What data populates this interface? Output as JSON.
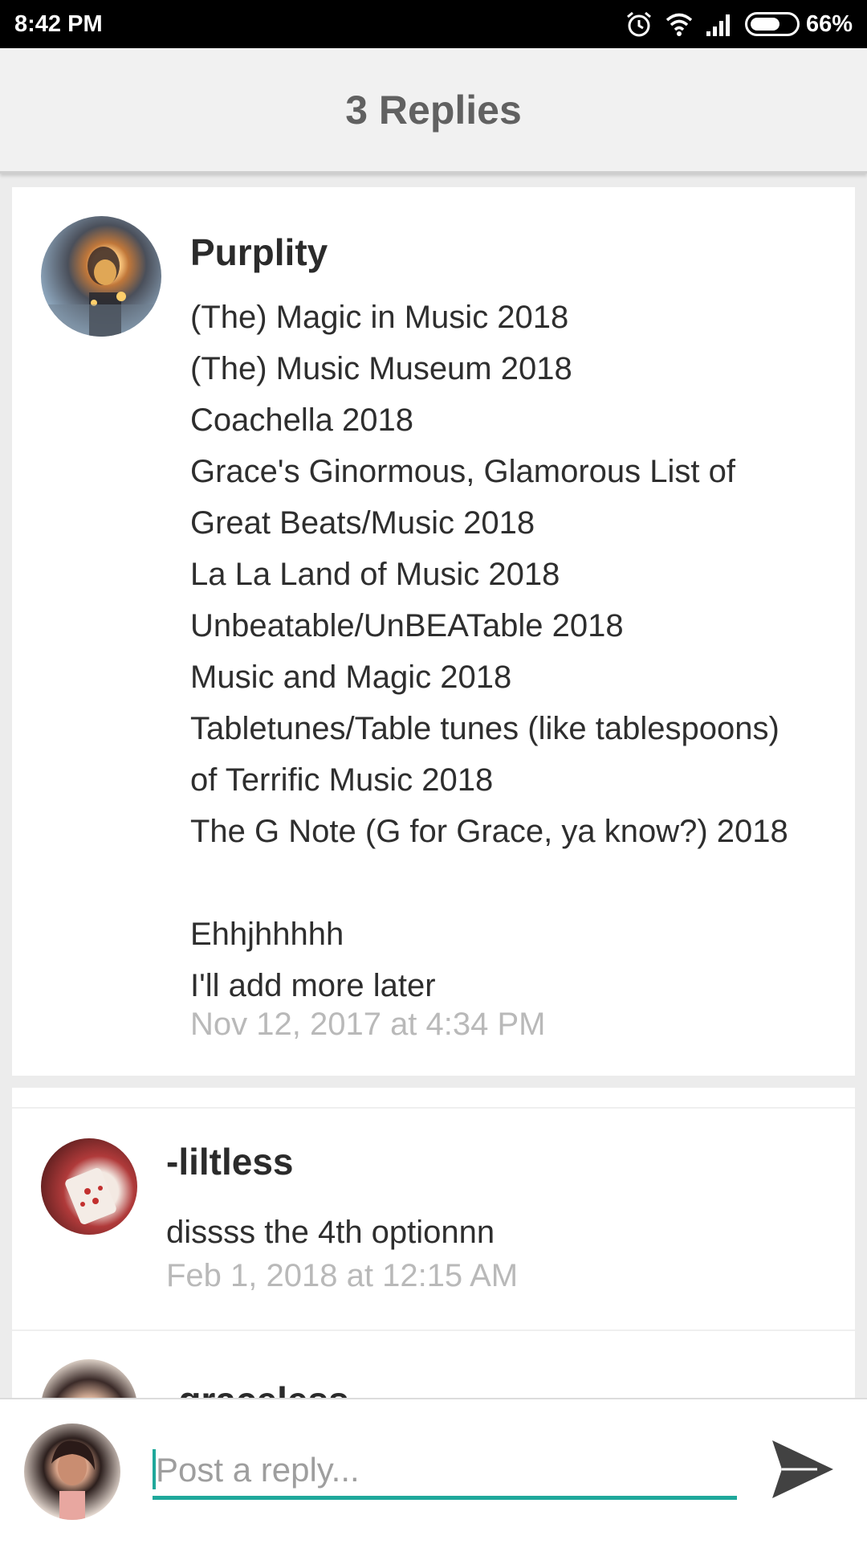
{
  "status_bar": {
    "time": "8:42 PM",
    "battery": "66%",
    "battery_level": 0.66
  },
  "header": {
    "title": "3 Replies"
  },
  "post": {
    "username": "Purplity",
    "lines": [
      "(The) Magic in Music 2018",
      "(The) Music Museum 2018",
      "Coachella 2018",
      "Grace's Ginormous, Glamorous List of",
      "Great Beats/Music 2018",
      "La La Land of Music 2018",
      "Unbeatable/UnBEATable 2018",
      "Music and Magic 2018",
      "Tabletunes/Table tunes (like tablespoons)",
      "of Terrific Music 2018",
      "The G Note (G for Grace, ya know?) 2018",
      "",
      "Ehhjhhhhh",
      "I'll add more later"
    ],
    "timestamp": "Nov 12, 2017 at 4:34 PM"
  },
  "replies": [
    {
      "username": "-liltless",
      "text": "dissss the 4th optionnn",
      "timestamp": "Feb 1, 2018 at 12:15 AM"
    },
    {
      "username": "-graceless"
    }
  ],
  "reply_bar": {
    "placeholder": "Post a reply..."
  },
  "colors": {
    "accent": "#1fa89b",
    "header_bg": "#f1f1f1",
    "title": "#616161",
    "timestamp": "#b9b9b9"
  }
}
